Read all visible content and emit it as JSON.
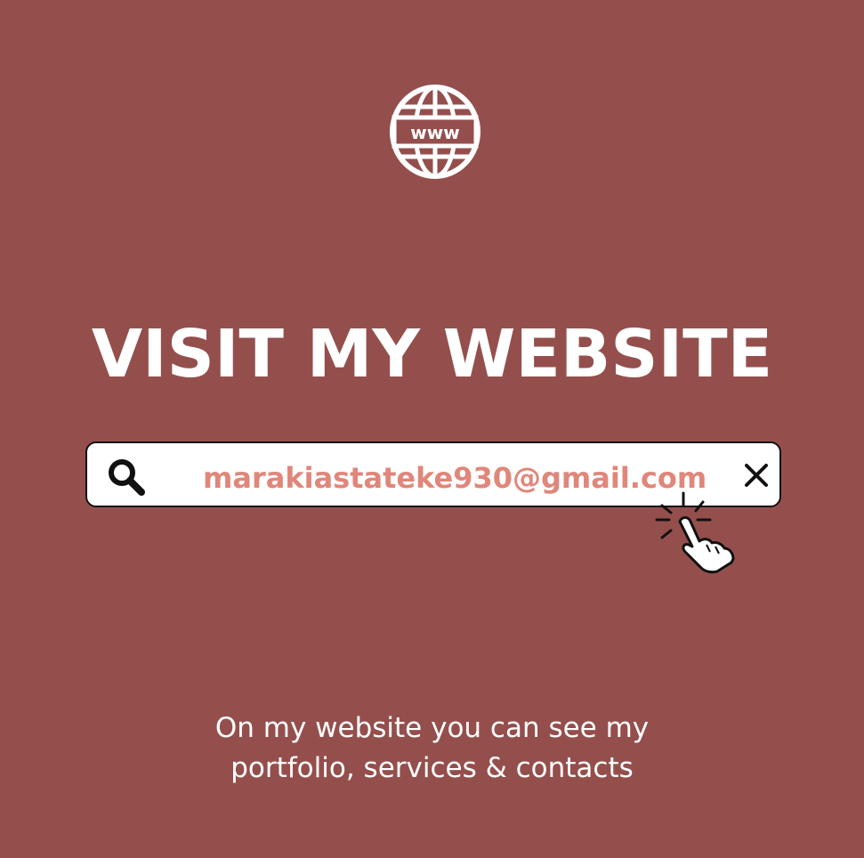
{
  "icons": {
    "globe": "www-globe-icon",
    "search": "search-icon",
    "clear": "close-icon",
    "cursor": "hand-pointer-click-icon"
  },
  "globe_label": "www",
  "headline": "VISIT MY WEBSITE",
  "search": {
    "value": "marakiastateke930@gmail.com"
  },
  "caption": {
    "line1": "On my website you can see my",
    "line2": "portfolio, services & contacts"
  },
  "colors": {
    "background": "#944f4d",
    "accent_text": "#e0867a",
    "white": "#ffffff",
    "dark": "#111111"
  }
}
